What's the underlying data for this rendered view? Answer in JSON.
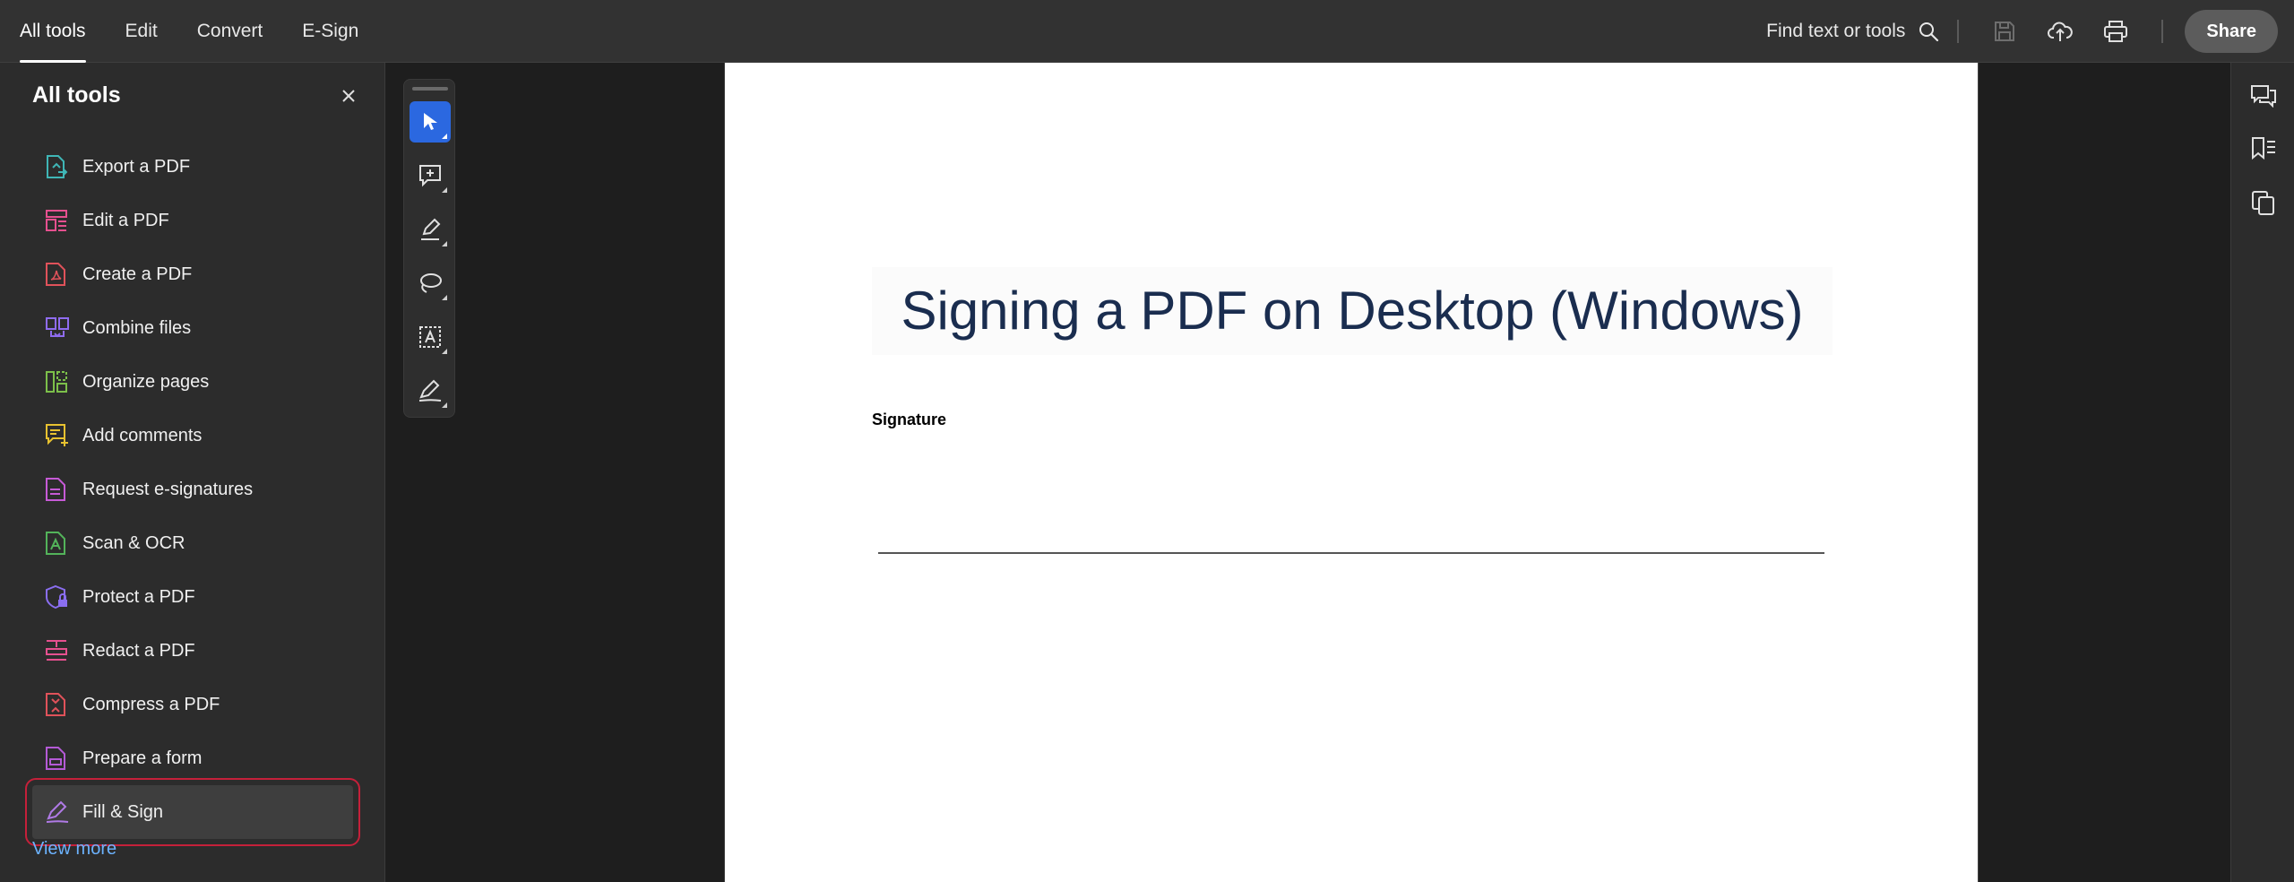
{
  "topnav": {
    "tabs": [
      {
        "label": "All tools",
        "active": true
      },
      {
        "label": "Edit",
        "active": false
      },
      {
        "label": "Convert",
        "active": false
      },
      {
        "label": "E-Sign",
        "active": false
      }
    ]
  },
  "toolbar": {
    "find_label": "Find text or tools",
    "icons": [
      "save-icon",
      "upload-cloud-icon",
      "print-icon"
    ],
    "share_label": "Share"
  },
  "leftpanel": {
    "title": "All tools",
    "tools": [
      {
        "label": "Export a PDF",
        "icon": "export-pdf-icon",
        "color": "#3fb6b6"
      },
      {
        "label": "Edit a PDF",
        "icon": "edit-pdf-icon",
        "color": "#e6508f"
      },
      {
        "label": "Create a PDF",
        "icon": "create-pdf-icon",
        "color": "#e0525a"
      },
      {
        "label": "Combine files",
        "icon": "combine-files-icon",
        "color": "#8f6cf0"
      },
      {
        "label": "Organize pages",
        "icon": "organize-pages-icon",
        "color": "#7cc04a"
      },
      {
        "label": "Add comments",
        "icon": "add-comments-icon",
        "color": "#e8c230"
      },
      {
        "label": "Request e-signatures",
        "icon": "request-esign-icon",
        "color": "#c65ad6"
      },
      {
        "label": "Scan & OCR",
        "icon": "scan-ocr-icon",
        "color": "#53b35a"
      },
      {
        "label": "Protect a PDF",
        "icon": "protect-pdf-icon",
        "color": "#8a6ef0"
      },
      {
        "label": "Redact a PDF",
        "icon": "redact-pdf-icon",
        "color": "#e6508f"
      },
      {
        "label": "Compress a PDF",
        "icon": "compress-pdf-icon",
        "color": "#e0525a"
      },
      {
        "label": "Prepare a form",
        "icon": "prepare-form-icon",
        "color": "#b45ad6"
      },
      {
        "label": "Fill & Sign",
        "icon": "fill-sign-icon",
        "color": "#b07ae6",
        "selected": true
      }
    ],
    "view_more": "View more"
  },
  "float_toolbar": {
    "tools": [
      "select-cursor-icon",
      "add-comment-icon",
      "highlight-pen-icon",
      "draw-lasso-icon",
      "text-select-icon",
      "sign-pen-icon"
    ],
    "active_index": 0
  },
  "document": {
    "title": "Signing a PDF on Desktop (Windows)",
    "signature_label": "Signature"
  },
  "rightrail": {
    "icons": [
      "comments-panel-icon",
      "bookmarks-panel-icon",
      "pages-panel-icon"
    ]
  },
  "colors": {
    "accent": "#2b68e0",
    "link": "#6cb3ff",
    "selection_outline": "#c5203a",
    "title_text": "#1a2d4f"
  }
}
